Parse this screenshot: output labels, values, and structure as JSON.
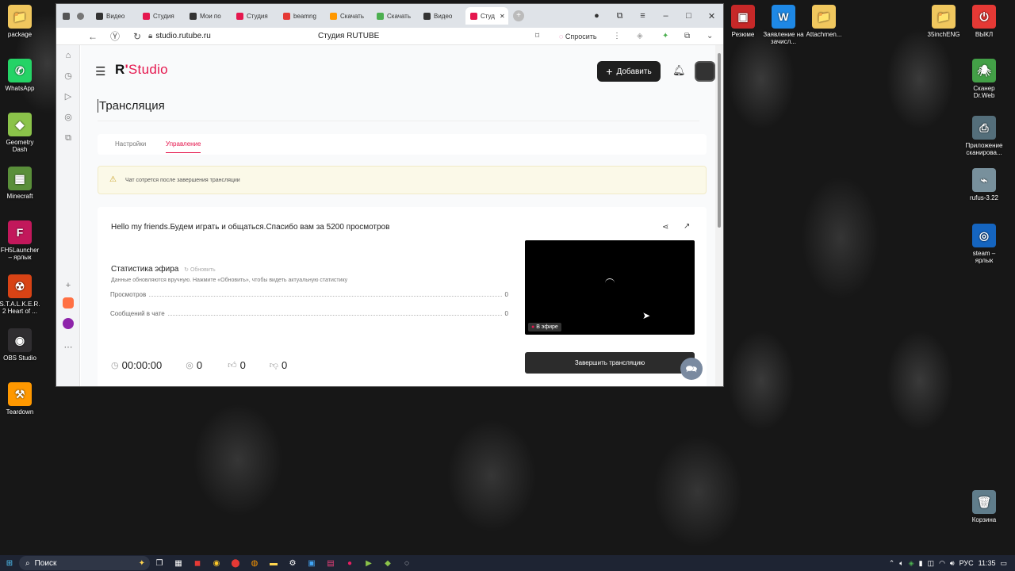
{
  "desktop": {
    "left_icons": [
      {
        "label": "package",
        "glyph": "📁",
        "color": "#f0c75e"
      },
      {
        "label": "WhatsApp",
        "glyph": "✆",
        "color": "#25d366"
      },
      {
        "label": "Geometry Dash",
        "glyph": "◆",
        "color": "#8bc34a"
      },
      {
        "label": "Minecraft",
        "glyph": "▦",
        "color": "#5a8f3a"
      },
      {
        "label": "FH5Launcher – ярлык",
        "glyph": "F",
        "color": "#c2185b"
      },
      {
        "label": "S.T.A.L.K.E.R. 2 Heart of ...",
        "glyph": "☢",
        "color": "#d84315"
      },
      {
        "label": "OBS Studio",
        "glyph": "◉",
        "color": "#302e31"
      },
      {
        "label": "Teardown",
        "glyph": "⚒",
        "color": "#ff9800"
      }
    ],
    "top_icons": [
      {
        "label": "Резюме",
        "glyph": "▣",
        "color": "#c62828"
      },
      {
        "label": "Заявление на зачисл...",
        "glyph": "W",
        "color": "#1e88e5"
      },
      {
        "label": "Attachmen...",
        "glyph": "📁",
        "color": "#f0c75e"
      },
      {
        "label": "35inchENG",
        "glyph": "📁",
        "color": "#f0c75e"
      },
      {
        "label": "ВЫКЛ",
        "glyph": "⏻",
        "color": "#e53935"
      }
    ],
    "right_icons": [
      {
        "label": "Сканер Dr.Web",
        "glyph": "🕷",
        "color": "#43a047"
      },
      {
        "label": "Приложение сканирова...",
        "glyph": "⎙",
        "color": "#546e7a"
      },
      {
        "label": "rufus-3.22",
        "glyph": "⌁",
        "color": "#78909c"
      },
      {
        "label": "steam – ярлык",
        "glyph": "◎",
        "color": "#1565c0"
      },
      {
        "label": "Корзина",
        "glyph": "🗑",
        "color": "#607d8b"
      }
    ]
  },
  "browser": {
    "tabs": [
      {
        "label": "Видео",
        "color": "#333"
      },
      {
        "label": "Студия",
        "color": "#e5174e"
      },
      {
        "label": "Мои по",
        "color": "#333"
      },
      {
        "label": "Студия",
        "color": "#e5174e"
      },
      {
        "label": "beamng",
        "color": "#e53935"
      },
      {
        "label": "Скачать",
        "color": "#ff9800"
      },
      {
        "label": "Скачать",
        "color": "#4caf50"
      },
      {
        "label": "Видео",
        "color": "#333"
      }
    ],
    "active_tab": "Студ",
    "url": "studio.rutube.ru",
    "page_title": "Студия RUTUBE",
    "ask_label": "Спросить"
  },
  "studio": {
    "logo": "R'Studio",
    "add_button": "Добавить",
    "page_heading": "Трансляция",
    "tabs": [
      "Настройки",
      "Управление"
    ],
    "active_tab_index": 1,
    "warning": "Чат сотрется после завершения трансляции",
    "stream_title": "Hello my friends.Будем играть и общаться.Спасибо вам за 5200 просмотров",
    "stats_title": "Статистика эфира",
    "refresh_label": "Обновить",
    "stats_note": "Данные обновляются вручную. Нажмите «Обновить», чтобы видеть актуальную статистику",
    "stats": [
      {
        "label": "Просмотров",
        "value": "0"
      },
      {
        "label": "Сообщений в чате",
        "value": "0"
      }
    ],
    "timer": "00:00:00",
    "viewers": "0",
    "likes": "0",
    "dislikes": "0",
    "live_badge": "В эфире",
    "end_button": "Завершить трансляцию",
    "accent": "#e5174e"
  },
  "taskbar": {
    "search_placeholder": "Поиск",
    "lang": "РУС",
    "time": "11:35"
  }
}
